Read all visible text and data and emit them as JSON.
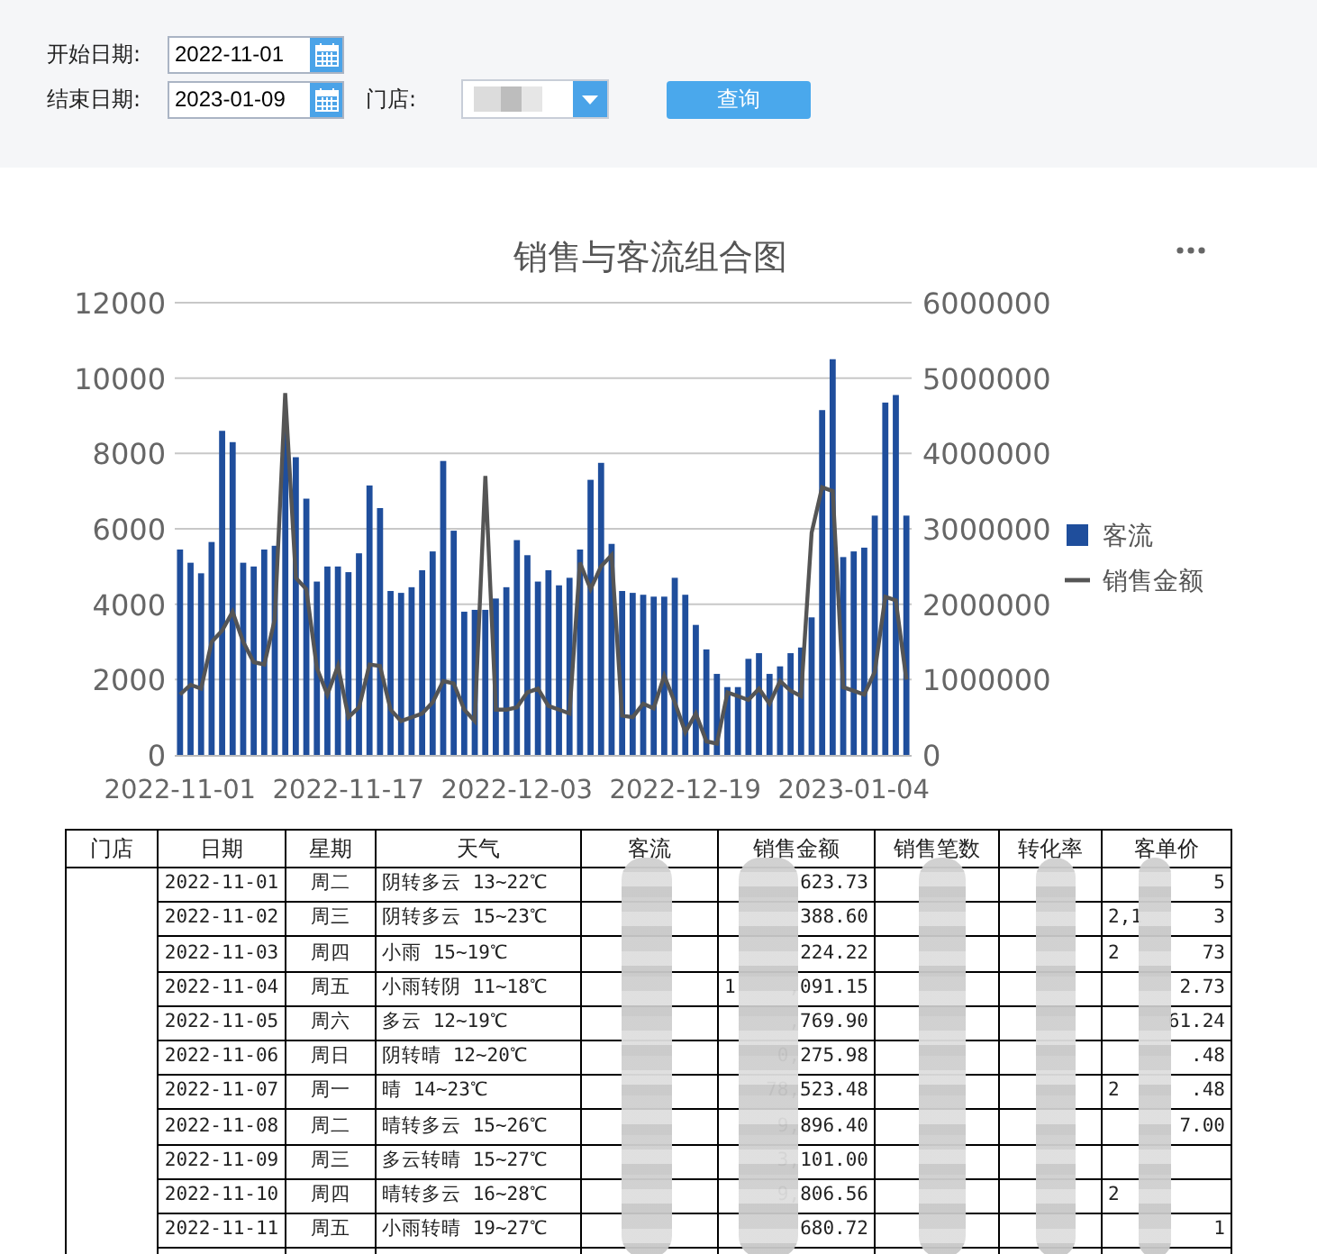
{
  "filters": {
    "start_label": "开始日期:",
    "start_value": "2022-11-01",
    "end_label": "结束日期:",
    "end_value": "2023-01-09",
    "store_label": "门店:",
    "query_button": "查询"
  },
  "chart": {
    "chart_data": {
      "type": "bar",
      "title": "销售与客流组合图",
      "categories": [
        "2022-11-01",
        null,
        null,
        null,
        null,
        null,
        null,
        null,
        null,
        null,
        null,
        null,
        null,
        null,
        null,
        null,
        "2022-11-17",
        null,
        null,
        null,
        null,
        null,
        null,
        null,
        null,
        null,
        null,
        null,
        null,
        null,
        null,
        null,
        "2022-12-03",
        null,
        null,
        null,
        null,
        null,
        null,
        null,
        null,
        null,
        null,
        null,
        null,
        null,
        null,
        null,
        "2022-12-19",
        null,
        null,
        null,
        null,
        null,
        null,
        null,
        null,
        null,
        null,
        null,
        null,
        null,
        null,
        null,
        "2023-01-04",
        null,
        null,
        null,
        null,
        null
      ],
      "series": [
        {
          "name": "客流",
          "color": "#1f4e9c",
          "values": [
            5450,
            5100,
            4820,
            5650,
            8600,
            8300,
            5100,
            5000,
            5450,
            5550,
            8700,
            7900,
            6800,
            4600,
            5000,
            5000,
            4850,
            5350,
            7150,
            6550,
            4350,
            4300,
            4450,
            4900,
            5400,
            7800,
            5950,
            3800,
            3850,
            3850,
            4150,
            4450,
            5700,
            5300,
            4600,
            4900,
            4500,
            4700,
            5450,
            7300,
            7750,
            5600,
            4350,
            4300,
            4250,
            4200,
            4200,
            4700,
            4250,
            3450,
            2800,
            2150,
            1800,
            1800,
            2550,
            2700,
            2150,
            2350,
            2700,
            2850,
            3650,
            9150,
            10500,
            5250,
            5400,
            5500,
            6350,
            9350,
            9550,
            6350
          ]
        },
        {
          "name": "销售金额",
          "color": "#555555",
          "type": "line",
          "axis": "y2",
          "values": [
            800000,
            930000,
            880000,
            1500000,
            1650000,
            1900000,
            1500000,
            1230000,
            1200000,
            1800000,
            4800000,
            2350000,
            2200000,
            1150000,
            800000,
            1180000,
            500000,
            630000,
            1200000,
            1180000,
            600000,
            450000,
            500000,
            550000,
            700000,
            980000,
            950000,
            600000,
            450000,
            3700000,
            600000,
            600000,
            630000,
            830000,
            880000,
            650000,
            600000,
            550000,
            2550000,
            2200000,
            2500000,
            2650000,
            520000,
            500000,
            680000,
            620000,
            1050000,
            700000,
            300000,
            550000,
            180000,
            150000,
            830000,
            780000,
            730000,
            880000,
            680000,
            980000,
            850000,
            780000,
            2950000,
            3550000,
            3500000,
            900000,
            850000,
            800000,
            1100000,
            2100000,
            2050000,
            1000000
          ]
        }
      ],
      "ylim": [
        0,
        12000
      ],
      "yticks": [
        0,
        2000,
        4000,
        6000,
        8000,
        10000,
        12000
      ],
      "grid": true,
      "legend": "right",
      "y2lim": [
        0,
        6000000
      ],
      "y2ticks": [
        0,
        1000000,
        2000000,
        3000000,
        4000000,
        5000000,
        6000000
      ]
    }
  },
  "table": {
    "columns": [
      "门店",
      "日期",
      "星期",
      "天气",
      "客流",
      "销售金额",
      "销售笔数",
      "转化率",
      "客单价"
    ],
    "rows": [
      {
        "date": "2022-11-01",
        "weekday": "周二",
        "weather": "阴转多云 13~22℃",
        "sales_amount": "623.73",
        "avg_price": "5"
      },
      {
        "date": "2022-11-02",
        "weekday": "周三",
        "weather": "阴转多云 15~23℃",
        "sales_amount": "388.60",
        "avg_price_prefix": "2,1",
        "avg_price": "3"
      },
      {
        "date": "2022-11-03",
        "weekday": "周四",
        "weather": "小雨 15~19℃",
        "sales_amount": "224.22",
        "avg_price_prefix": "2",
        "avg_price": "73"
      },
      {
        "date": "2022-11-04",
        "weekday": "周五",
        "weather": "小雨转阴 11~18℃",
        "sales_amount_prefix": "1",
        "sales_amount": ",091.15",
        "avg_price": "2.73"
      },
      {
        "date": "2022-11-05",
        "weekday": "周六",
        "weather": "多云 12~19℃",
        "sales_amount": ",769.90",
        "avg_price": "61.24"
      },
      {
        "date": "2022-11-06",
        "weekday": "周日",
        "weather": "阴转晴 12~20℃",
        "sales_amount": "0,275.98",
        "avg_price": ".48"
      },
      {
        "date": "2022-11-07",
        "weekday": "周一",
        "weather": "晴 14~23℃",
        "sales_amount": "78,523.48",
        "avg_price_prefix": "2",
        "avg_price": ".48"
      },
      {
        "date": "2022-11-08",
        "weekday": "周二",
        "weather": "晴转多云 15~26℃",
        "sales_amount": "9,896.40",
        "avg_price": "7.00"
      },
      {
        "date": "2022-11-09",
        "weekday": "周三",
        "weather": "多云转晴 15~27℃",
        "sales_amount": "3,101.00"
      },
      {
        "date": "2022-11-10",
        "weekday": "周四",
        "weather": "晴转多云 16~28℃",
        "sales_amount": "9,806.56",
        "avg_price_prefix": "2"
      },
      {
        "date": "2022-11-11",
        "weekday": "周五",
        "weather": "小雨转晴 19~27℃",
        "sales_amount": "680.72",
        "avg_price": "1"
      }
    ]
  }
}
